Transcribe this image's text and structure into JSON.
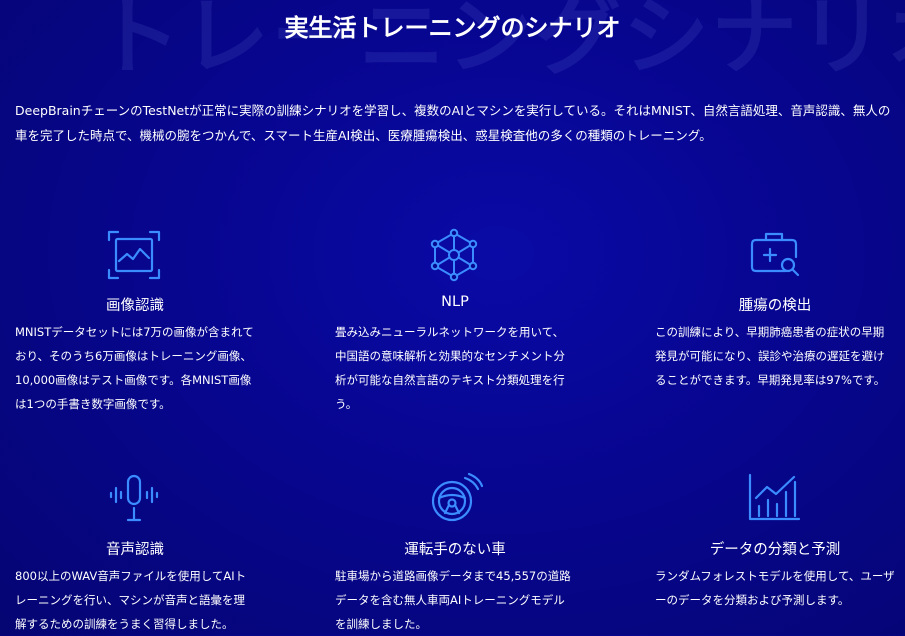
{
  "watermark": "トレーニングシナリオ",
  "title": "実生活トレーニングのシナリオ",
  "intro": "DeepBrainチェーンのTestNetが正常に実際の訓練シナリオを学習し、複数のAIとマシンを実行している。それはMNIST、自然言語処理、音声認識、無人の車を完了した時点で、機械の腕をつかんで、スマート生産AI検出、医療腫瘍検出、惑星検査他の多くの種類のトレーニング。",
  "accent_color": "#3a8cff",
  "cards": [
    {
      "icon": "image-frame-icon",
      "heading": "画像認識",
      "desc": "MNISTデータセットには7万の画像が含まれており、そのうち6万画像はトレーニング画像、10,000画像はテスト画像です。各MNIST画像は1つの手書き数字画像です。"
    },
    {
      "icon": "neural-network-icon",
      "heading": "NLP",
      "desc": "畳み込みニューラルネットワークを用いて、中国語の意味解析と効果的なセンチメント分析が可能な自然言語のテキスト分類処理を行う。"
    },
    {
      "icon": "medical-bag-search-icon",
      "heading": "腫瘍の検出",
      "desc": "この訓練により、早期肺癌患者の症状の早期発見が可能になり、誤診や治療の遅延を避けることができます。早期発見率は97%です。"
    },
    {
      "icon": "microphone-icon",
      "heading": "音声認識",
      "desc": "800以上のWAV音声ファイルを使用してAIトレーニングを行い、マシンが音声と語彙を理解するための訓練をうまく習得しました。"
    },
    {
      "icon": "steering-wheel-icon",
      "heading": "運転手のない車",
      "desc": "駐車場から道路画像データまで45,557の道路データを含む無人車両AIトレーニングモデルを訓練しました。"
    },
    {
      "icon": "bar-chart-icon",
      "heading": "データの分類と予測",
      "desc": "ランダムフォレストモデルを使用して、ユーザーのデータを分類および予測します。"
    }
  ]
}
